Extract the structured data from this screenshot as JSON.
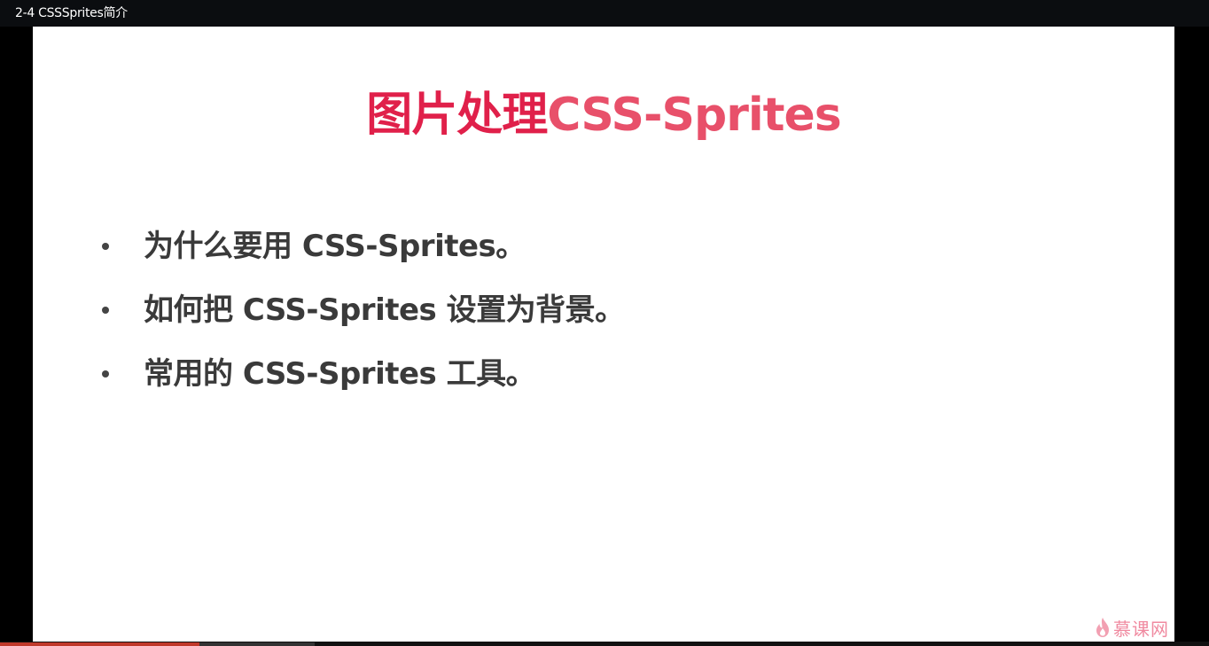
{
  "window": {
    "title": "2-4 CSSSprites简介"
  },
  "slide": {
    "title_cn": "图片处理",
    "title_en": "CSS-Sprites",
    "bullets": [
      "为什么要用 CSS-Sprites。",
      "如何把 CSS-Sprites 设置为背景。",
      "常用的 CSS-Sprites 工具。"
    ],
    "title_colors": {
      "cn": "#e0204a",
      "en": "#e8506a"
    },
    "text_color": "#3a3a3a"
  },
  "watermark": {
    "text": "慕课网",
    "icon": "flame-logo-icon"
  },
  "player": {
    "progress_played_fraction": 0.165,
    "progress_buffered_fraction": 0.26
  }
}
